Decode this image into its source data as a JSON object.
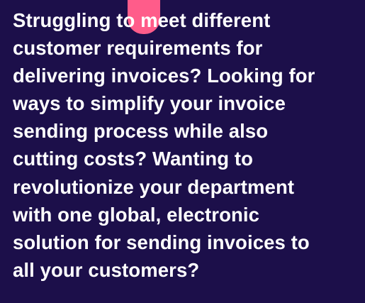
{
  "intro": {
    "lines": [
      "Struggling to meet different",
      "customer requirements for",
      "delivering invoices? Looking for",
      "ways to simplify your invoice",
      "sending process while also",
      "cutting costs? Wanting to",
      "revolutionize your department",
      "with one global, electronic",
      "solution for sending invoices to",
      "all your customers?"
    ]
  },
  "colors": {
    "background": "#1c0f4a",
    "text": "#ffffff",
    "accent": "#ff5c8a"
  }
}
